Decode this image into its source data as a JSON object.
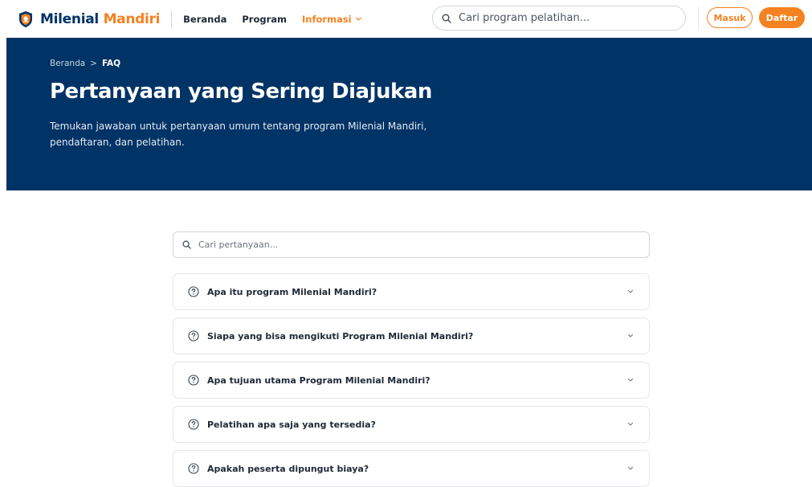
{
  "navbar": {
    "brand_part1": "Milenial",
    "brand_part2": "Mandiri",
    "links": [
      "Beranda",
      "Program",
      "Informasi"
    ],
    "active_link": "Informasi",
    "search_placeholder": "Cari program pelatihan...",
    "login_label": "Masuk",
    "register_label": "Daftar"
  },
  "hero": {
    "breadcrumb": [
      "Beranda",
      "FAQ"
    ],
    "breadcrumb_sep": ">",
    "title": "Pertanyaan yang Sering Diajukan",
    "subtitle": "Temukan jawaban untuk pertanyaan umum tentang program Milenial Mandiri, pendaftaran, dan pelatihan."
  },
  "faq": {
    "search_placeholder": "Cari pertanyaan...",
    "items": [
      "Apa itu program Milenial Mandiri?",
      "Siapa yang bisa mengikuti Program Milenial Mandiri?",
      "Apa tujuan utama Program Milenial Mandiri?",
      "Pelatihan apa saja yang tersedia?",
      "Apakah peserta dipungut biaya?"
    ]
  },
  "colors": {
    "primary": "#003366",
    "accent": "#f58220"
  },
  "icons": [
    "shield-logo-icon",
    "chevron-down-icon",
    "search-icon",
    "question-circle-icon"
  ]
}
